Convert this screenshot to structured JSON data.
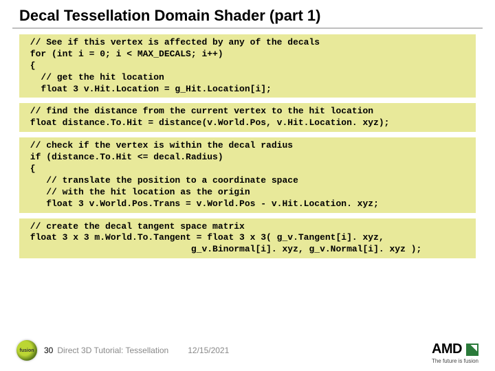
{
  "title": "Decal Tessellation Domain Shader (part 1)",
  "code_blocks": [
    " // See if this vertex is affected by any of the decals\n for (int i = 0; i < MAX_DECALS; i++)\n {\n   // get the hit location\n   float 3 v.Hit.Location = g_Hit.Location[i];",
    " // find the distance from the current vertex to the hit location\n float distance.To.Hit = distance(v.World.Pos, v.Hit.Location. xyz);",
    " // check if the vertex is within the decal radius\n if (distance.To.Hit <= decal.Radius)\n {\n    // translate the position to a coordinate space\n    // with the hit location as the origin\n    float 3 v.World.Pos.Trans = v.World.Pos - v.Hit.Location. xyz;",
    " // create the decal tangent space matrix\n float 3 x 3 m.World.To.Tangent = float 3 x 3( g_v.Tangent[i]. xyz,\n                               g_v.Binormal[i]. xyz, g_v.Normal[i]. xyz );"
  ],
  "footer": {
    "badge_label": "fusion",
    "slide_number": "30",
    "deck_name": "Direct 3D Tutorial: Tessellation",
    "date": "12/15/2021"
  },
  "brand": {
    "name": "AMD",
    "tagline": "The future is fusion"
  }
}
